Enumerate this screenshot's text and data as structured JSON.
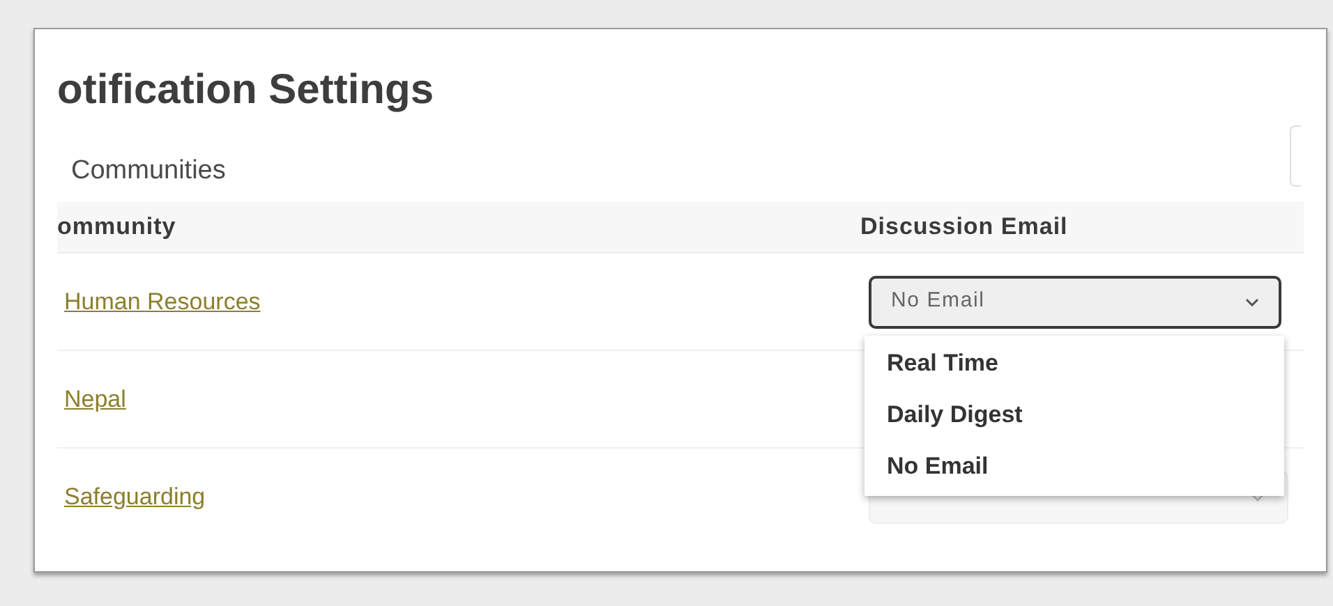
{
  "title": "otification Settings",
  "section": "Communities",
  "table": {
    "columns": [
      "ommunity",
      "Discussion Email"
    ],
    "rows": [
      {
        "community": "Human Resources",
        "email": {
          "value": "No Email",
          "expanded": true,
          "options": [
            "Real Time",
            "Daily Digest",
            "No Email"
          ]
        }
      },
      {
        "community": "Nepal"
      },
      {
        "community": "Safeguarding",
        "email": {
          "expanded": false
        }
      }
    ]
  }
}
